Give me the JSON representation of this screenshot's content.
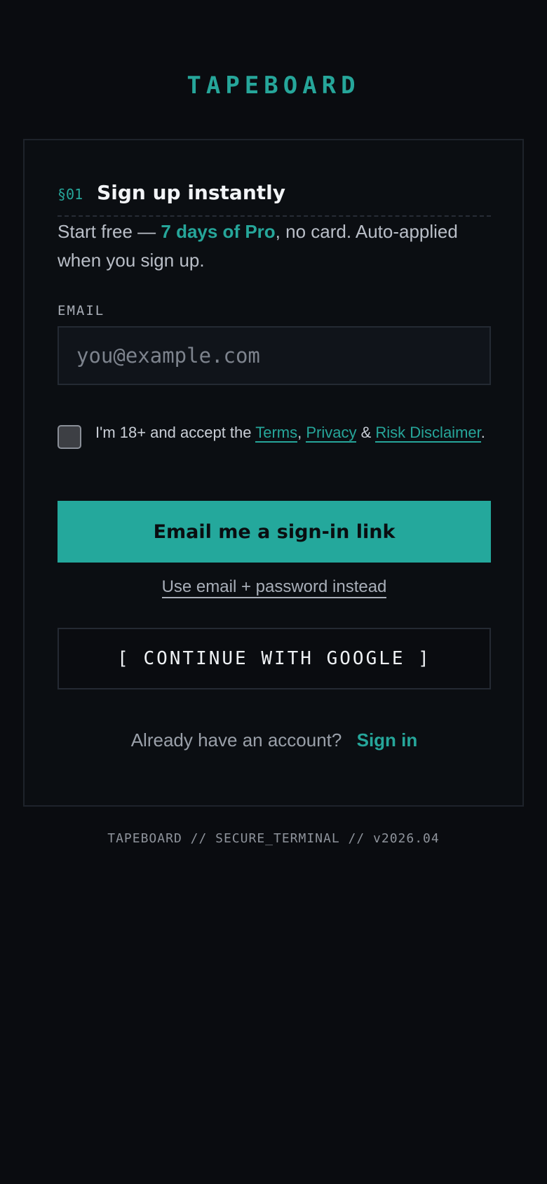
{
  "brand": "TAPEBOARD",
  "section": {
    "number": "§01",
    "title": "Sign up instantly"
  },
  "intro": {
    "prefix": "Start free — ",
    "highlight": "7 days of Pro",
    "suffix": ", no card. Auto-applied when you sign up."
  },
  "email": {
    "label": "EMAIL",
    "placeholder": "you@example.com",
    "value": ""
  },
  "consent": {
    "checked": false,
    "text_before": "I'm 18+ and accept the ",
    "terms": "Terms",
    "comma": ", ",
    "privacy": "Privacy",
    "amp": " & ",
    "risk": "Risk Disclaimer",
    "period": "."
  },
  "buttons": {
    "primary": "Email me a sign-in link",
    "alt_link": "Use email + password instead",
    "google": "[ CONTINUE WITH GOOGLE ]"
  },
  "signin": {
    "prompt": "Already have an account?",
    "link": "Sign in"
  },
  "footer": "TAPEBOARD // SECURE_TERMINAL // v2026.04",
  "colors": {
    "accent": "#26a69a",
    "background": "#0a0c10"
  }
}
